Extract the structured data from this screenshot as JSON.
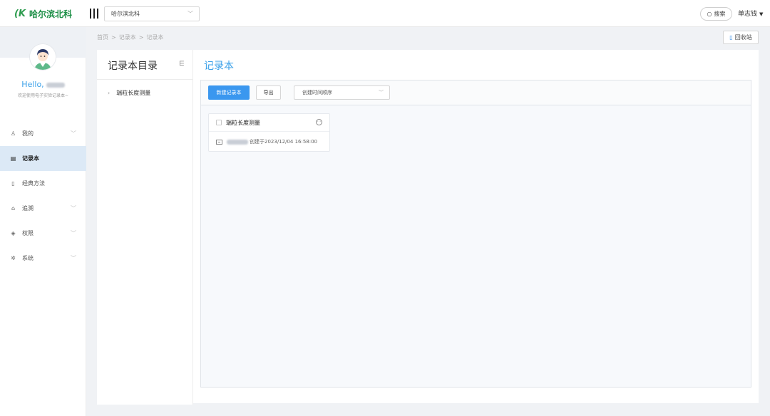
{
  "brand": {
    "mark": "(K",
    "name": "哈尔滨北科"
  },
  "header": {
    "org_select": "哈尔滨北科",
    "search_label": "搜索",
    "user_name": "单志钱"
  },
  "sidebar": {
    "hello": "Hello,",
    "welcome": "欢迎使用电子实验记录本~",
    "items": [
      {
        "label": "我的",
        "icon": "user-icon",
        "expandable": true,
        "active": false
      },
      {
        "label": "记录本",
        "icon": "notebook-icon",
        "expandable": false,
        "active": true
      },
      {
        "label": "经典方法",
        "icon": "book-icon",
        "expandable": false,
        "active": false
      },
      {
        "label": "追溯",
        "icon": "trace-icon",
        "expandable": true,
        "active": false
      },
      {
        "label": "权限",
        "icon": "shield-icon",
        "expandable": true,
        "active": false
      },
      {
        "label": "系统",
        "icon": "gear-icon",
        "expandable": true,
        "active": false
      }
    ]
  },
  "breadcrumb": [
    "首页",
    "记录本",
    "记录本"
  ],
  "recycle_bin": "回收站",
  "directory": {
    "title": "记录本目录",
    "items": [
      "端粒长度测量"
    ]
  },
  "main": {
    "title": "记录本",
    "new_button": "新建记录本",
    "export_button": "导出",
    "sort_select": "创建时间顺序",
    "notebook": {
      "title": "端粒长度测量",
      "created": "创建于2023/12/04 16:58:00"
    }
  },
  "colors": {
    "accent": "#3a97ef",
    "brand": "#1d8f47",
    "active_nav": "#dce9f6"
  }
}
